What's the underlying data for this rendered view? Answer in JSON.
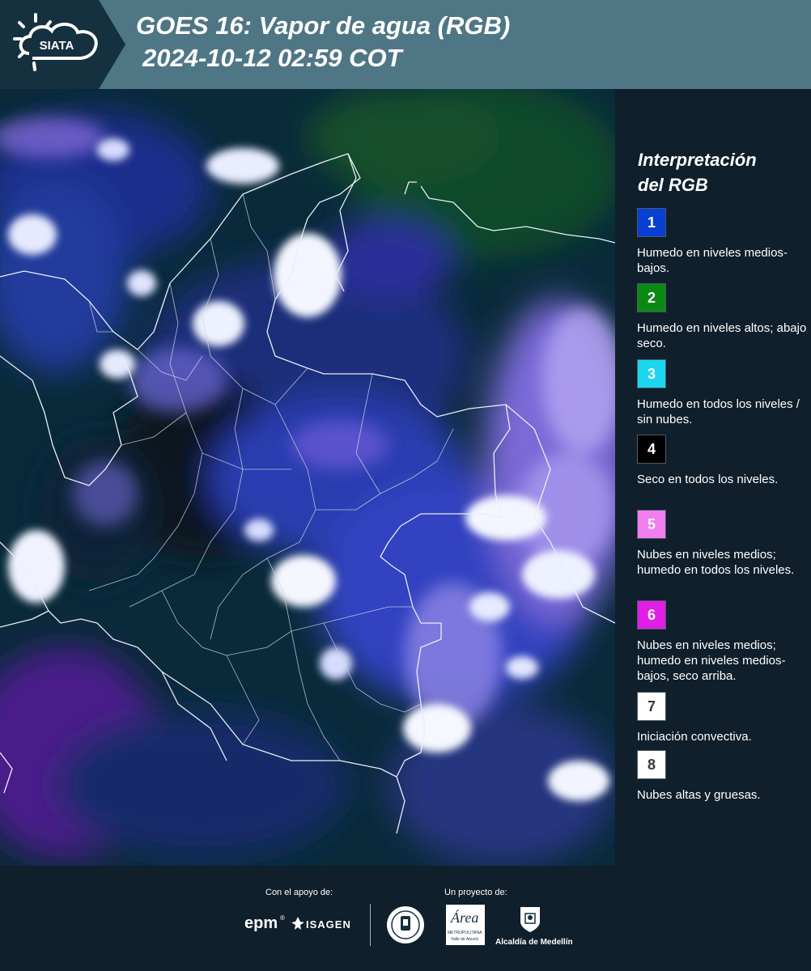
{
  "header": {
    "brand": "SIATA",
    "title_line1": "GOES 16: Vapor de agua (RGB)",
    "title_line2": "2024-10-12 02:59 COT"
  },
  "legend": {
    "title_line1": "Interpretación",
    "title_line2": "del RGB",
    "items": [
      {
        "num": "1",
        "color": "#0a3fd4",
        "text_color": "#ffffff",
        "text": "Humedo en niveles medios-bajos."
      },
      {
        "num": "2",
        "color": "#0a8a14",
        "text_color": "#ffffff",
        "text": "Humedo en niveles altos; abajo seco."
      },
      {
        "num": "3",
        "color": "#1cd6f0",
        "text_color": "#ffffff",
        "text": "Humedo en todos los niveles / sin nubes."
      },
      {
        "num": "4",
        "color": "#000000",
        "text_color": "#ffffff",
        "text": "Seco en todos los niveles."
      },
      {
        "num": "5",
        "color": "#f27ef0",
        "text_color": "#ffffff",
        "text": "Nubes en niveles medios; humedo en todos los niveles."
      },
      {
        "num": "6",
        "color": "#e01ee6",
        "text_color": "#ffffff",
        "text": "Nubes en niveles medios; humedo en niveles medios-bajos, seco arriba."
      },
      {
        "num": "7",
        "color": "#ffffff",
        "text_color": "#3a3a3a",
        "text": "Iniciación convectiva."
      },
      {
        "num": "8",
        "color": "#ffffff",
        "text_color": "#3a3a3a",
        "text": "Nubes altas y gruesas."
      }
    ]
  },
  "footer": {
    "support_label": "Con el apoyo de:",
    "project_label": "Un proyecto de:",
    "epm": "epm",
    "isagen": "ISAGEN",
    "area_name": "Área",
    "area_sub1": "METROPOLITANA",
    "area_sub2": "Valle de Aburrá",
    "medellin": "Alcaldía de Medellín"
  }
}
